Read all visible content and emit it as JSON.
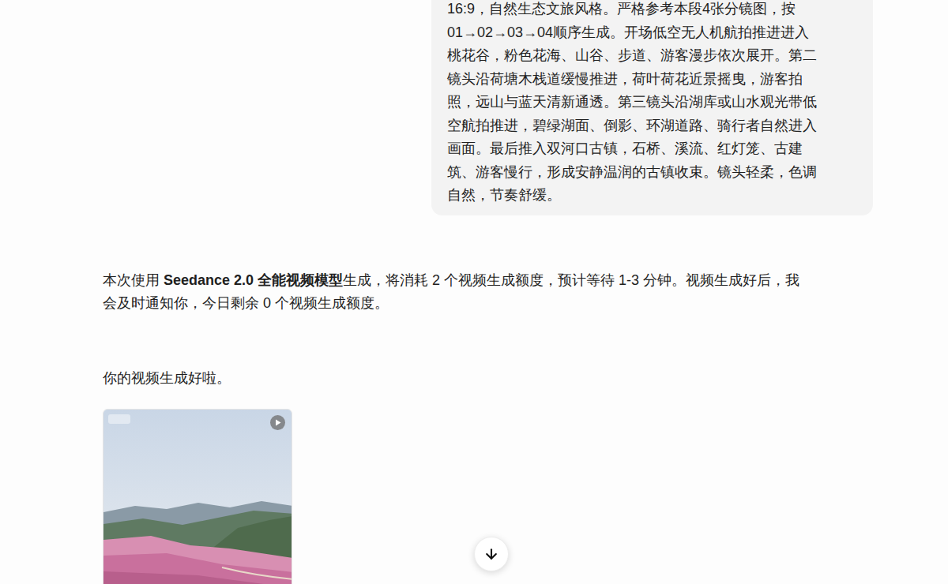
{
  "user_message": {
    "lines": [
      "16:9，自然生态文旅风格。严格参考本段4张分镜图，按",
      "01→02→03→04顺序生成。开场低空无人机航拍推进进入",
      "桃花谷，粉色花海、山谷、步道、游客漫步依次展开。第二",
      "镜头沿荷塘木栈道缓慢推进，荷叶荷花近景摇曳，游客拍",
      "照，远山与蓝天清新通透。第三镜头沿湖库或山水观光带低",
      "空航拍推进，碧绿湖面、倒影、环湖道路、骑行者自然进入",
      "画面。最后推入双河口古镇，石桥、溪流、红灯笼、古建",
      "筑、游客慢行，形成安静温润的古镇收束。镜头轻柔，色调",
      "自然，节奏舒缓。"
    ]
  },
  "status": {
    "before": "本次使用 ",
    "model": "Seedance 2.0 全能视频模型",
    "lines": [
      "生成，将消耗 2 个视频生成额度，预计等待 1-3 分钟。视频生成好后，我",
      "会及时通知你，今日剩余 0 个视频生成额度。"
    ]
  },
  "done_message": "你的视频生成好啦。",
  "video": {
    "playing": false
  }
}
